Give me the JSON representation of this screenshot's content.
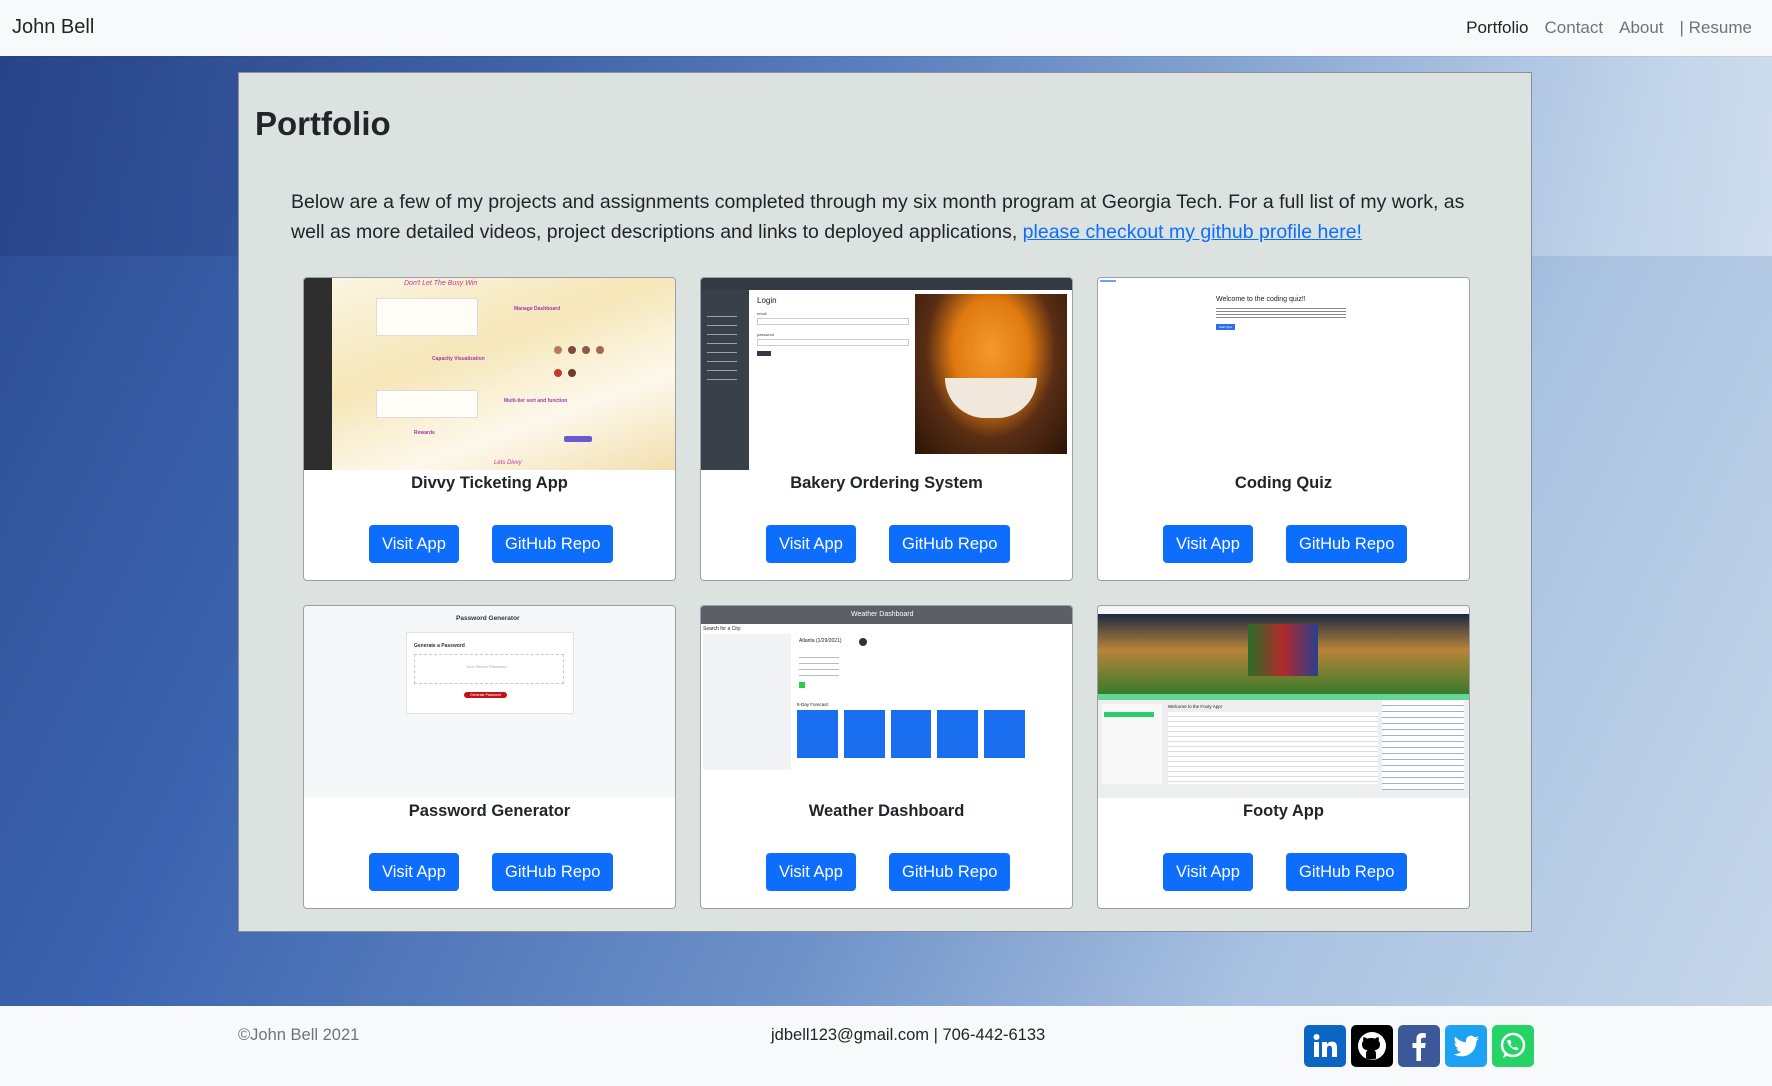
{
  "navbar": {
    "brand": "John Bell",
    "links": [
      {
        "label": "Portfolio"
      },
      {
        "label": "Contact"
      },
      {
        "label": "About"
      },
      {
        "label": "| Resume"
      }
    ]
  },
  "portfolio": {
    "title": "Portfolio",
    "intro_text": "Below are a few of my projects and assignments completed through my six month program at Georgia Tech. For a full list of my work, as well as more detailed videos, project descriptions and links to deployed applications, ",
    "intro_link": "please checkout my github profile here!",
    "projects": [
      {
        "title": "Divvy Ticketing App",
        "visit_label": "Visit App",
        "repo_label": "GitHub Repo",
        "thumb_lines": [
          "Don't Let The Busy Win",
          "Manage Dashboard",
          "Capacity Visualization",
          "Multi-tier sort and function",
          "Rewards",
          "Lets Divvy"
        ]
      },
      {
        "title": "Bakery Ordering System",
        "visit_label": "Visit App",
        "repo_label": "GitHub Repo",
        "thumb_lines": [
          "Login",
          "email",
          "password"
        ]
      },
      {
        "title": "Coding Quiz",
        "visit_label": "Visit App",
        "repo_label": "GitHub Repo",
        "thumb_lines": [
          "Welcome to the coding quiz!!",
          "Start Quiz"
        ]
      },
      {
        "title": "Password Generator",
        "visit_label": "Visit App",
        "repo_label": "GitHub Repo",
        "thumb_lines": [
          "Password Generator",
          "Generate a Password",
          "Your Secure Password",
          "Generate Password"
        ]
      },
      {
        "title": "Weather Dashboard",
        "visit_label": "Visit App",
        "repo_label": "GitHub Repo",
        "thumb_lines": [
          "Weather Dashboard",
          "Search for a City:",
          "Atlanta (1/29/2021)",
          "5-Day Forecast:"
        ]
      },
      {
        "title": "Footy App",
        "visit_label": "Visit App",
        "repo_label": "GitHub Repo",
        "thumb_lines": [
          "Welcome to the Footy App!"
        ]
      }
    ]
  },
  "footer": {
    "copyright": "©John Bell 2021",
    "contact": "jdbell123@gmail.com | 706-442-6133",
    "socials": [
      {
        "icon": "linkedin-icon",
        "color": "#0a66c2"
      },
      {
        "icon": "github-icon",
        "color": "#000000"
      },
      {
        "icon": "facebook-icon",
        "color": "#3b5998"
      },
      {
        "icon": "twitter-icon",
        "color": "#1da1f2"
      },
      {
        "icon": "whatsapp-icon",
        "color": "#25d366"
      }
    ]
  },
  "colors": {
    "primary": "#0d6efd",
    "panel_bg": "#dbe2e0",
    "navbar_bg": "#f8f9fa"
  }
}
